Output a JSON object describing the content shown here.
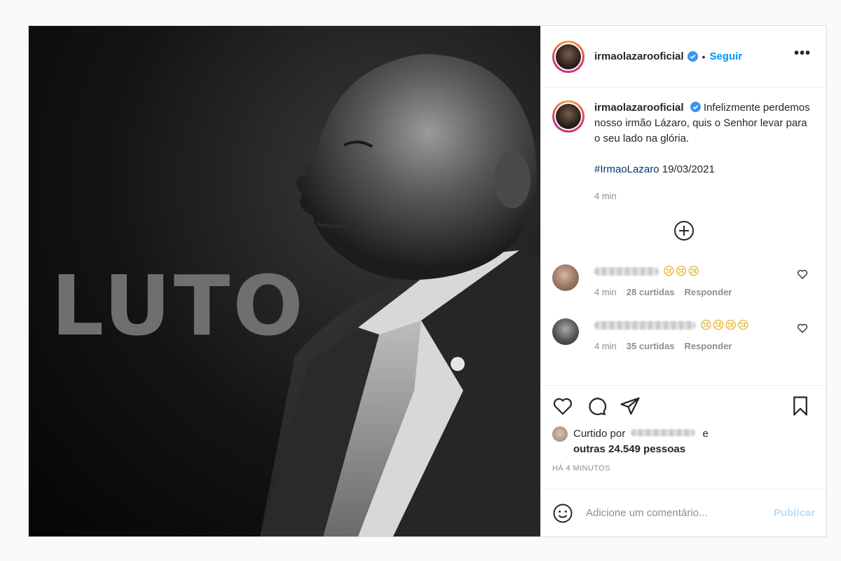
{
  "photo": {
    "overlay_text": "LUTO"
  },
  "post": {
    "username": "irmaolazarooficial",
    "separator": "•",
    "follow_label": "Seguir",
    "more_label": "•••"
  },
  "caption": {
    "username": "irmaolazarooficial",
    "text": "Infelizmente perdemos nosso irmão Lázaro, quis o Senhor levar para o seu lado na glória.",
    "hashtag": "#IrmaoLazaro",
    "date": "19/03/2021",
    "time": "4 min"
  },
  "comments": [
    {
      "emojis": "😢😢😢",
      "time": "4 min",
      "likes": "28 curtidas",
      "reply_label": "Responder"
    },
    {
      "emojis": "😢😢😢😢",
      "time": "4 min",
      "likes": "35 curtidas",
      "reply_label": "Responder"
    }
  ],
  "likes": {
    "prefix": "Curtido por",
    "conj": "e",
    "others": "outras 24.549 pessoas",
    "ago": "HÁ 4 MINUTOS"
  },
  "add_comment": {
    "placeholder": "Adicione um comentário...",
    "publish_label": "Publicar"
  },
  "colors": {
    "link_blue": "#0095f6",
    "hashtag_blue": "#00376b",
    "publish_disabled": "#b2dffc"
  }
}
